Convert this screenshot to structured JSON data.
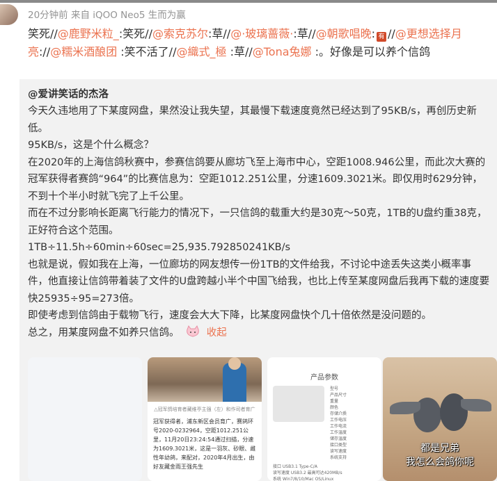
{
  "post": {
    "meta": "20分钟前 来自 iQOO Neo5 生而为赢",
    "repost_segments": [
      {
        "t": "text",
        "v": "笑死//"
      },
      {
        "t": "at",
        "v": "@鹿野米粒_"
      },
      {
        "t": "text",
        "v": ":笑死//"
      },
      {
        "t": "at",
        "v": "@索克苏尔"
      },
      {
        "t": "text",
        "v": ":草//"
      },
      {
        "t": "at",
        "v": "@·玻璃蔷薇·"
      },
      {
        "t": "text",
        "v": ":草//"
      },
      {
        "t": "at",
        "v": "@朝歌唱晚"
      },
      {
        "t": "text",
        "v": ":"
      },
      {
        "t": "emoji",
        "v": "有"
      },
      {
        "t": "text",
        "v": "//"
      },
      {
        "t": "at",
        "v": "@更想选择月亮"
      },
      {
        "t": "text",
        "v": "://"
      },
      {
        "t": "at",
        "v": "@糯米酒酿团"
      },
      {
        "t": "text",
        "v": " :笑不活了//"
      },
      {
        "t": "at",
        "v": "@織式_極"
      },
      {
        "t": "text",
        "v": " :草//"
      },
      {
        "t": "at",
        "v": "@Tona兔娜"
      },
      {
        "t": "text",
        "v": " :。好像是可以养个信鸽"
      }
    ]
  },
  "original": {
    "author": "@爱讲笑话的杰洛",
    "paragraphs": [
      "今天久违地用了下某度网盘，果然没让我失望，其最慢下载速度竟然已经达到了95KB/s，再创历史新低。",
      "95KB/s，这是个什么概念？",
      "在2020年的上海信鸽秋赛中，参赛信鸽要从廊坊飞至上海市中心，空距1008.946公里，而此次大赛的冠军获得者赛鸽“964”的比赛信息为：空距1012.251公里，分速1609.3021米。即仅用时629分钟，不到十个半小时就飞完了上千公里。",
      "而在不过分影响长距离飞行能力的情况下，一只信鸽的载重大约是30克～50克，1TB的U盘约重38克，正好符合这个范围。",
      "1TB÷11.5h÷60min÷60sec=25,935.792850241KB/s",
      "也就是说，假如我在上海，一位廊坊的网友想传一份1TB的文件给我，不讨论中途丢失这类小概率事件，他直接让信鸽带着装了文件的U盘跨越小半个中国飞给我，也比上传至某度网盘后我再下载的速度要快25935÷95=273倍。",
      "即使考虑到信鸽由于载物飞行，速度会大大下降，比某度网盘快个几十倍依然是没问题的。"
    ],
    "last_line": "总之，用某度网盘不如养只信鸽。",
    "unfold": "收起",
    "thumbs": {
      "t2_caption": "△冠军鸽培育者藏维亭主强（左）和作司者育广",
      "t2_body": "冠军获得者，浦东新区会员育广，赛鸽环号2020-0232964，空距1012.251公里，11月20日23:24:54通过扫描，分速为1609.3021米，这是一羽灰、砂眼、雌性年幼鸽，来配对，2020年4月出生，由好友藏金雨王强先生",
      "t3_title": "产品参数",
      "t3_specs": [
        "型号",
        "产品尺寸",
        "重量",
        "颜色",
        "存储介质",
        "工作电压",
        "工作电流",
        "工作温度",
        "储存温度",
        "接口类型",
        "读写速度",
        "系统支持"
      ],
      "t3_specs2": [
        "接口 USB3.1 Type-C/A",
        "读写速度 USB3.2 最高可达420MB/s",
        "系统 Win7/8/10/Mac OS/Linux"
      ],
      "t4_cap1": "都是兄弟",
      "t4_cap2": "我怎么会鸽你呢"
    }
  }
}
